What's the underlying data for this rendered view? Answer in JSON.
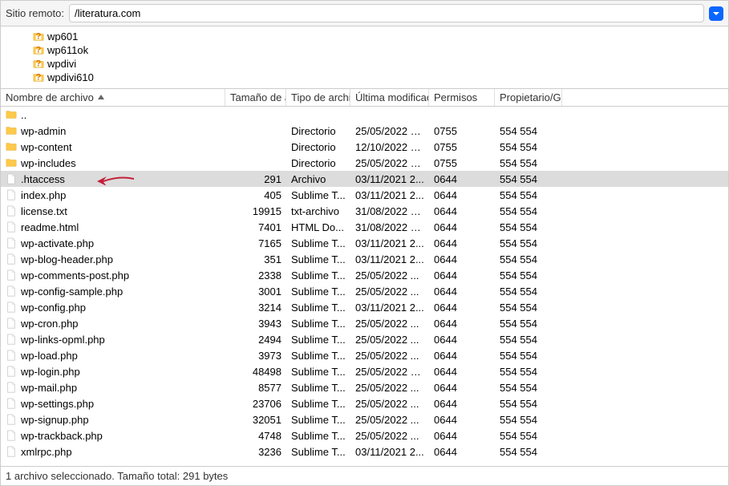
{
  "header": {
    "label": "Sitio remoto:",
    "path": "/literatura.com"
  },
  "tree": {
    "items": [
      {
        "name": "wp601"
      },
      {
        "name": "wp611ok"
      },
      {
        "name": "wpdivi"
      },
      {
        "name": "wpdivi610"
      }
    ]
  },
  "columns": {
    "name": "Nombre de archivo",
    "size": "Tamaño de ar",
    "type": "Tipo de archiv",
    "date": "Última modificació",
    "perm": "Permisos",
    "owner": "Propietario/Gru"
  },
  "files": [
    {
      "name": "..",
      "size": "",
      "type": "",
      "date": "",
      "perm": "",
      "owner": "",
      "kind": "up"
    },
    {
      "name": "wp-admin",
      "size": "",
      "type": "Directorio",
      "date": "25/05/2022 0...",
      "perm": "0755",
      "owner": "554 554",
      "kind": "folder"
    },
    {
      "name": "wp-content",
      "size": "",
      "type": "Directorio",
      "date": "12/10/2022 0...",
      "perm": "0755",
      "owner": "554 554",
      "kind": "folder"
    },
    {
      "name": "wp-includes",
      "size": "",
      "type": "Directorio",
      "date": "25/05/2022 0...",
      "perm": "0755",
      "owner": "554 554",
      "kind": "folder"
    },
    {
      "name": ".htaccess",
      "size": "291",
      "type": "Archivo",
      "date": "03/11/2021 2...",
      "perm": "0644",
      "owner": "554 554",
      "kind": "file",
      "selected": true,
      "arrow": true
    },
    {
      "name": "index.php",
      "size": "405",
      "type": "Sublime T...",
      "date": "03/11/2021 2...",
      "perm": "0644",
      "owner": "554 554",
      "kind": "file"
    },
    {
      "name": "license.txt",
      "size": "19915",
      "type": "txt-archivo",
      "date": "31/08/2022 0...",
      "perm": "0644",
      "owner": "554 554",
      "kind": "file"
    },
    {
      "name": "readme.html",
      "size": "7401",
      "type": "HTML Do...",
      "date": "31/08/2022 0...",
      "perm": "0644",
      "owner": "554 554",
      "kind": "file"
    },
    {
      "name": "wp-activate.php",
      "size": "7165",
      "type": "Sublime T...",
      "date": "03/11/2021 2...",
      "perm": "0644",
      "owner": "554 554",
      "kind": "file"
    },
    {
      "name": "wp-blog-header.php",
      "size": "351",
      "type": "Sublime T...",
      "date": "03/11/2021 2...",
      "perm": "0644",
      "owner": "554 554",
      "kind": "file"
    },
    {
      "name": "wp-comments-post.php",
      "size": "2338",
      "type": "Sublime T...",
      "date": "25/05/2022 ...",
      "perm": "0644",
      "owner": "554 554",
      "kind": "file"
    },
    {
      "name": "wp-config-sample.php",
      "size": "3001",
      "type": "Sublime T...",
      "date": "25/05/2022 ...",
      "perm": "0644",
      "owner": "554 554",
      "kind": "file"
    },
    {
      "name": "wp-config.php",
      "size": "3214",
      "type": "Sublime T...",
      "date": "03/11/2021 2...",
      "perm": "0644",
      "owner": "554 554",
      "kind": "file"
    },
    {
      "name": "wp-cron.php",
      "size": "3943",
      "type": "Sublime T...",
      "date": "25/05/2022 ...",
      "perm": "0644",
      "owner": "554 554",
      "kind": "file"
    },
    {
      "name": "wp-links-opml.php",
      "size": "2494",
      "type": "Sublime T...",
      "date": "25/05/2022 ...",
      "perm": "0644",
      "owner": "554 554",
      "kind": "file"
    },
    {
      "name": "wp-load.php",
      "size": "3973",
      "type": "Sublime T...",
      "date": "25/05/2022 ...",
      "perm": "0644",
      "owner": "554 554",
      "kind": "file"
    },
    {
      "name": "wp-login.php",
      "size": "48498",
      "type": "Sublime T...",
      "date": "25/05/2022 0...",
      "perm": "0644",
      "owner": "554 554",
      "kind": "file"
    },
    {
      "name": "wp-mail.php",
      "size": "8577",
      "type": "Sublime T...",
      "date": "25/05/2022 ...",
      "perm": "0644",
      "owner": "554 554",
      "kind": "file"
    },
    {
      "name": "wp-settings.php",
      "size": "23706",
      "type": "Sublime T...",
      "date": "25/05/2022 ...",
      "perm": "0644",
      "owner": "554 554",
      "kind": "file"
    },
    {
      "name": "wp-signup.php",
      "size": "32051",
      "type": "Sublime T...",
      "date": "25/05/2022 ...",
      "perm": "0644",
      "owner": "554 554",
      "kind": "file"
    },
    {
      "name": "wp-trackback.php",
      "size": "4748",
      "type": "Sublime T...",
      "date": "25/05/2022 ...",
      "perm": "0644",
      "owner": "554 554",
      "kind": "file"
    },
    {
      "name": "xmlrpc.php",
      "size": "3236",
      "type": "Sublime T...",
      "date": "03/11/2021 2...",
      "perm": "0644",
      "owner": "554 554",
      "kind": "file"
    }
  ],
  "status": "1 archivo seleccionado. Tamaño total: 291 bytes"
}
